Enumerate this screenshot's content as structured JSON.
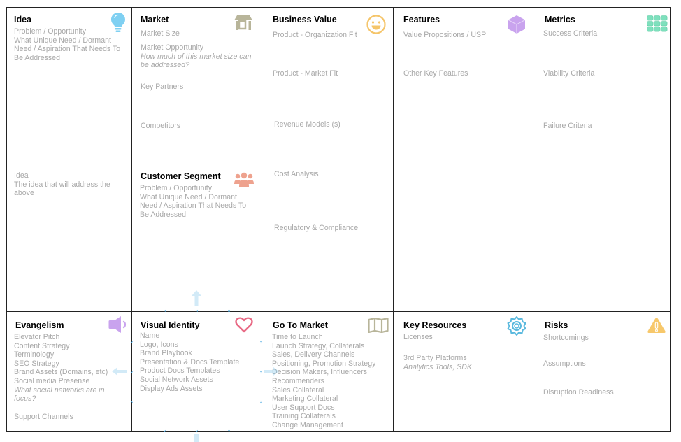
{
  "canvas": {
    "cells": {
      "idea": {
        "title": "Idea",
        "icon": "lightbulb-icon",
        "top_lines": [
          "Problem / Opportunity",
          "What Unique Need / Dormant",
          "Need / Aspiration That Needs To",
          "Be Addressed"
        ],
        "bottom_lines": [
          "Idea",
          "The idea that will address the",
          "above"
        ]
      },
      "market": {
        "title": "Market",
        "icon": "store-icon",
        "market_size": "Market Size",
        "market_opportunity": "Market Opportunity",
        "market_opportunity_hint": "How much of this market size can be addressed?",
        "key_partners": "Key Partners",
        "competitors": "Competitors"
      },
      "customer_segment": {
        "title": "Customer Segment",
        "icon": "users-icon",
        "lines": [
          "Problem / Opportunity",
          "What Unique Need / Dormant",
          "Need / Aspiration That Needs To",
          "Be Addressed"
        ]
      },
      "business_value": {
        "title": "Business Value",
        "icon": "smiley-icon",
        "items": [
          "Product - Organization Fit",
          "Product - Market Fit",
          "Revenue Models (s)",
          "Cost Analysis",
          "Regulatory & Compliance"
        ]
      },
      "features": {
        "title": "Features",
        "icon": "cube-icon",
        "items": [
          "Value Propositions / USP",
          "Other Key Features"
        ]
      },
      "metrics": {
        "title": "Metrics",
        "icon": "grid-icon",
        "items": [
          "Success Criteria",
          "Viability Criteria",
          "Failure Criteria"
        ]
      },
      "evangelism": {
        "title": "Evangelism",
        "icon": "megaphone-icon",
        "lines": [
          "Elevator Pitch",
          "Content Strategy",
          "Terminology",
          "SEO Strategy",
          "Brand Assets (Domains, etc)",
          "Social media Presense"
        ],
        "hint": "What social networks are in focus?",
        "support": "Support Channels"
      },
      "visual_identity": {
        "title": "Visual Identity",
        "icon": "heart-icon",
        "lines": [
          "Name",
          "Logo, Icons",
          "Brand Playbook",
          "Presentation & Docs Template",
          "Product Docs Templates",
          "Social Network Assets",
          "Display Ads Assets"
        ]
      },
      "go_to_market": {
        "title": "Go To Market",
        "icon": "map-icon",
        "lines": [
          "Time to Launch",
          "Launch Strategy, Collaterals",
          "Sales, Delivery Channels",
          "Positioning, Promotion Strategy",
          "Decision Makers, Influencers",
          "Recommenders",
          "Sales Collateral",
          "Marketing Collateral",
          "User Support Docs",
          "Training Collaterals",
          "Change Management"
        ]
      },
      "key_resources": {
        "title": "Key Resources",
        "icon": "gear-icon",
        "licenses": "Licenses",
        "platforms": "3rd Party Platforms",
        "platforms_hint": "Analytics Tools, SDK"
      },
      "risks": {
        "title": "Risks",
        "icon": "warning-icon",
        "items": [
          "Shortcomings",
          "Assumptions",
          "Disruption Readiness"
        ]
      }
    },
    "colors": {
      "lightbulb": "#7fd0f2",
      "store": "#b8b59a",
      "users": "#eea28e",
      "smiley": "#f5c56a",
      "cube": "#c9a3ee",
      "grid": "#7ee0bd",
      "megaphone": "#c9a3ee",
      "heart": "#e86a85",
      "map": "#b8b59a",
      "gear": "#5ab9de",
      "warning": "#f7c86b",
      "selection": "#4aa8e0"
    }
  }
}
